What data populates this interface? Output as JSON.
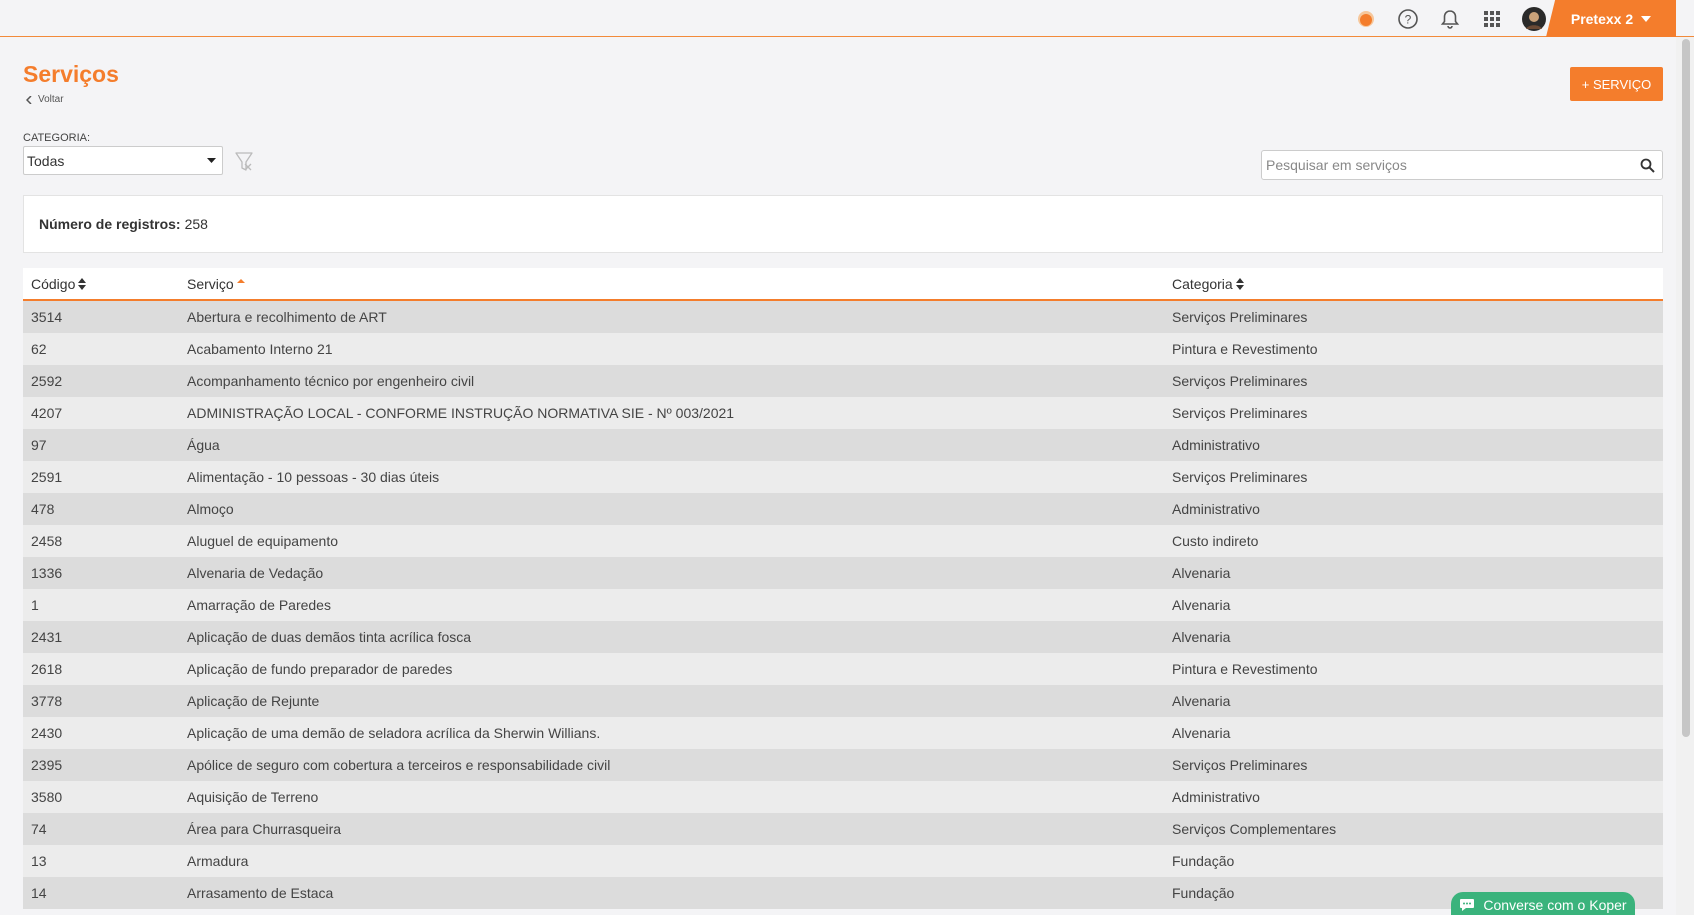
{
  "header": {
    "user_name": "Pretexx 2",
    "icons": [
      "status-dot-icon",
      "help-icon",
      "bell-icon",
      "apps-grid-icon",
      "avatar"
    ]
  },
  "page": {
    "title": "Serviços",
    "back_label": "Voltar",
    "add_button_label": "+ SERVIÇO"
  },
  "filters": {
    "category_label": "CATEGORIA:",
    "category_value": "Todas",
    "search_placeholder": "Pesquisar em serviços"
  },
  "records": {
    "label": "Número de registros:",
    "count": "258"
  },
  "table": {
    "headers": {
      "code": "Código",
      "service": "Serviço",
      "category": "Categoria"
    },
    "rows": [
      {
        "code": "3514",
        "service": "Abertura e recolhimento de ART",
        "category": "Serviços Preliminares"
      },
      {
        "code": "62",
        "service": "Acabamento Interno 21",
        "category": "Pintura e Revestimento"
      },
      {
        "code": "2592",
        "service": "Acompanhamento técnico por engenheiro civil",
        "category": "Serviços Preliminares"
      },
      {
        "code": "4207",
        "service": "ADMINISTRAÇÃO LOCAL - CONFORME INSTRUÇÃO NORMATIVA SIE - Nº 003/2021",
        "category": "Serviços Preliminares"
      },
      {
        "code": "97",
        "service": "Água",
        "category": "Administrativo"
      },
      {
        "code": "2591",
        "service": "Alimentação - 10 pessoas - 30 dias úteis",
        "category": "Serviços Preliminares"
      },
      {
        "code": "478",
        "service": "Almoço",
        "category": "Administrativo"
      },
      {
        "code": "2458",
        "service": "Aluguel de equipamento",
        "category": "Custo indireto"
      },
      {
        "code": "1336",
        "service": "Alvenaria de Vedação",
        "category": "Alvenaria"
      },
      {
        "code": "1",
        "service": "Amarração de Paredes",
        "category": "Alvenaria"
      },
      {
        "code": "2431",
        "service": "Aplicação de duas demãos tinta acrílica fosca",
        "category": "Alvenaria"
      },
      {
        "code": "2618",
        "service": "Aplicação de fundo preparador de paredes",
        "category": "Pintura e Revestimento"
      },
      {
        "code": "3778",
        "service": "Aplicação de Rejunte",
        "category": "Alvenaria"
      },
      {
        "code": "2430",
        "service": "Aplicação de uma demão de seladora acrílica da Sherwin Willians.",
        "category": "Alvenaria"
      },
      {
        "code": "2395",
        "service": "Apólice de seguro com cobertura a terceiros e responsabilidade civil",
        "category": "Serviços Preliminares"
      },
      {
        "code": "3580",
        "service": "Aquisição de Terreno",
        "category": "Administrativo"
      },
      {
        "code": "74",
        "service": "Área para Churrasqueira",
        "category": "Serviços Complementares"
      },
      {
        "code": "13",
        "service": "Armadura",
        "category": "Fundação"
      },
      {
        "code": "14",
        "service": "Arrasamento de Estaca",
        "category": "Fundação"
      }
    ]
  },
  "chat": {
    "label": "Converse com o Koper"
  },
  "colors": {
    "accent": "#f47d2c",
    "chat": "#3ab37c"
  }
}
